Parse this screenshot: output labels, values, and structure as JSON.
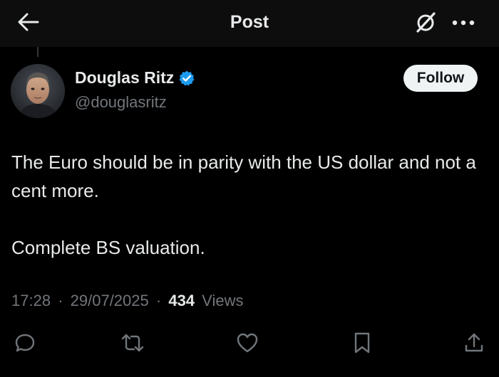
{
  "header": {
    "title": "Post",
    "back_icon": "arrow-left-icon",
    "grok_icon": "grok-icon",
    "more_icon": "more-horizontal-icon"
  },
  "author": {
    "name": "Douglas Ritz",
    "handle": "@douglasritz",
    "verified": true,
    "verified_color": "#1d9bf0",
    "follow_label": "Follow"
  },
  "post": {
    "paragraphs": [
      "The Euro should be in parity with the US dollar and not a cent more.",
      "Complete BS valuation."
    ],
    "time": "17:28",
    "date": "29/07/2025",
    "views_count": "434",
    "views_label": "Views",
    "separator": "·"
  },
  "actions": [
    {
      "icon": "reply-icon"
    },
    {
      "icon": "repost-icon"
    },
    {
      "icon": "like-icon"
    },
    {
      "icon": "bookmark-icon"
    },
    {
      "icon": "share-icon"
    }
  ],
  "colors": {
    "background": "#000000",
    "header_bg": "#0d0d0d",
    "text_primary": "#e7e9ea",
    "text_secondary": "#71767b",
    "follow_bg": "#eff3f4",
    "follow_text": "#0f1419"
  }
}
